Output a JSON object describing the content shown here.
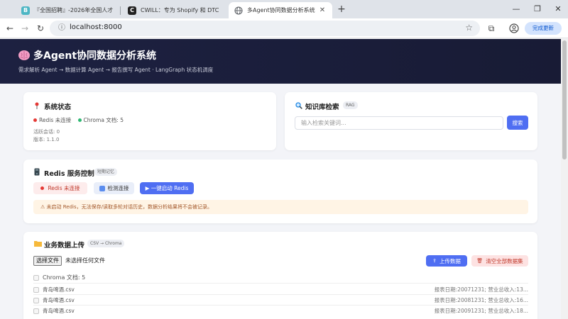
{
  "browser": {
    "tabs": [
      {
        "title": "『全国招聘』-2026年全国人才",
        "favicon": "B",
        "favicon_color": "#4db6c4"
      },
      {
        "title": "CWILL：专为 Shopify 和 DTC",
        "favicon": "C",
        "favicon_color": "#222222"
      },
      {
        "title": "多Agent协同数据分析系统",
        "favicon": "globe",
        "favicon_color": "#5f6368"
      }
    ],
    "new_tab": "+",
    "url": "localhost:8000",
    "update_label": "完成更新"
  },
  "header": {
    "title": "多Agent协同数据分析系统",
    "subtitle": "需求解析 Agent → 数据计算 Agent → 报告撰写 Agent · LangGraph 状态机调度",
    "brand_color": "#1d2141"
  },
  "system": {
    "title": "系统状态",
    "redis_label": "Redis 未连接",
    "chroma_label": "Chroma 文档: 5",
    "sessions": "活跃会话: 0",
    "version": "版本: 1.1.0"
  },
  "kb": {
    "title": "知识库检索",
    "tag": "RAG",
    "placeholder": "输入检索关键词...",
    "search_label": "搜索"
  },
  "redis": {
    "title": "Redis 服务控制",
    "tag": "短期记忆",
    "status_label": "Redis 未连接",
    "check_label": "检测连接",
    "start_label": "▶ 一键启动 Redis",
    "warning": "⚠ 未启动 Redis，无法保存/读取多轮对话历史，数据分析结果将不会被记录。"
  },
  "upload": {
    "title": "业务数据上传",
    "tag": "CSV → Chroma",
    "choose_label": "选择文件",
    "no_file": "未选择任何文件",
    "upload_label": "上传数据",
    "clear_label": "清空全部数据集",
    "docs_label": "Chroma 文档: 5",
    "files": [
      {
        "name": "青岛啤酒.csv",
        "meta": "报表日期:20071231; 营业总收入:13..."
      },
      {
        "name": "青岛啤酒.csv",
        "meta": "报表日期:20081231; 营业总收入:16..."
      },
      {
        "name": "青岛啤酒.csv",
        "meta": "报表日期:20091231; 营业总收入:18..."
      }
    ]
  },
  "colors": {
    "primary": "#4f6ef2",
    "status_red": "#e53935",
    "status_green": "#2eb872",
    "warning_bg": "#fff4e5"
  }
}
